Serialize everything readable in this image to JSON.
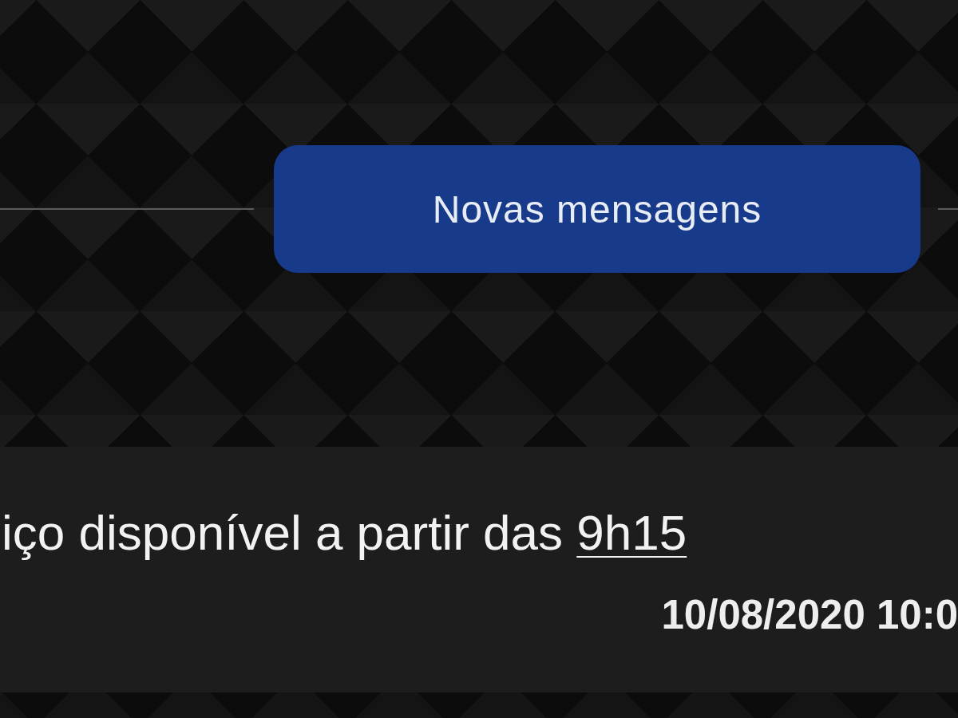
{
  "divider": {
    "label": "Novas mensagens"
  },
  "message": {
    "text": "iço disponível a partir das ",
    "link": "9h15",
    "timestamp": "10/08/2020 10:0"
  }
}
